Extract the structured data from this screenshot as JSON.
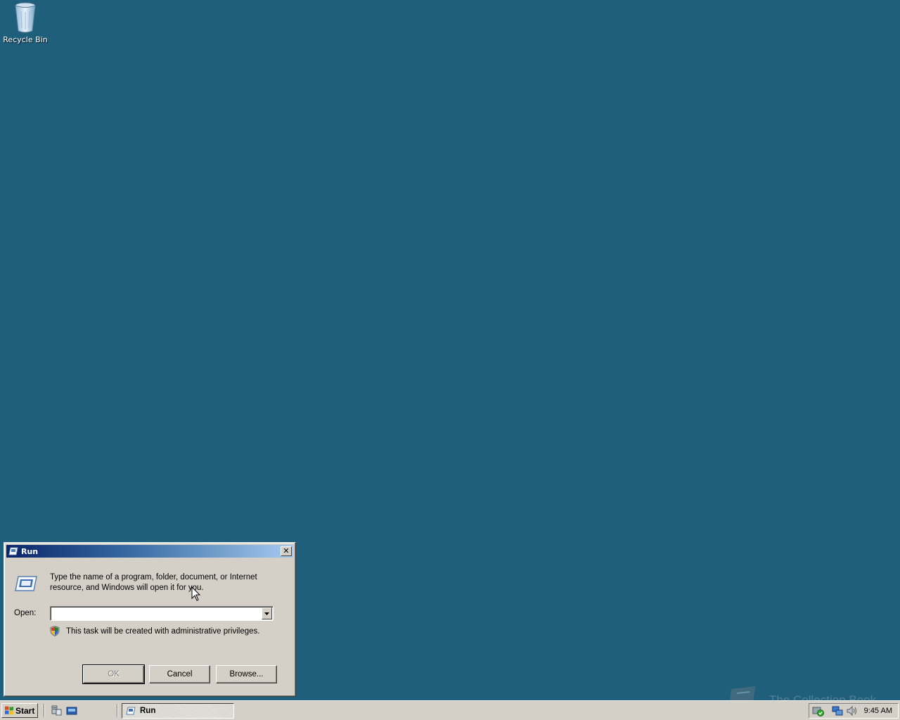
{
  "desktop": {
    "icons": [
      {
        "label": "Recycle Bin",
        "icon": "recycle-bin-icon"
      }
    ],
    "background_color": "#1f5f7c"
  },
  "run_dialog": {
    "title": "Run",
    "close_label": "✕",
    "description": "Type the name of a program, folder, document, or Internet resource, and Windows will open it for you.",
    "open_label": "Open:",
    "open_value": "",
    "admin_notice": "This task will be created with administrative privileges.",
    "buttons": {
      "ok": "OK",
      "cancel": "Cancel",
      "browse": "Browse..."
    }
  },
  "taskbar": {
    "start_label": "Start",
    "quick_launch": [
      "server-manager-icon",
      "show-desktop-icon"
    ],
    "tasks": [
      {
        "label": "Run",
        "icon": "run-icon",
        "active": true
      }
    ],
    "tray_icons": [
      "security-icon",
      "network-icon",
      "volume-icon"
    ],
    "clock": "9:45 AM"
  },
  "watermark": {
    "text": "The Collection Book"
  }
}
